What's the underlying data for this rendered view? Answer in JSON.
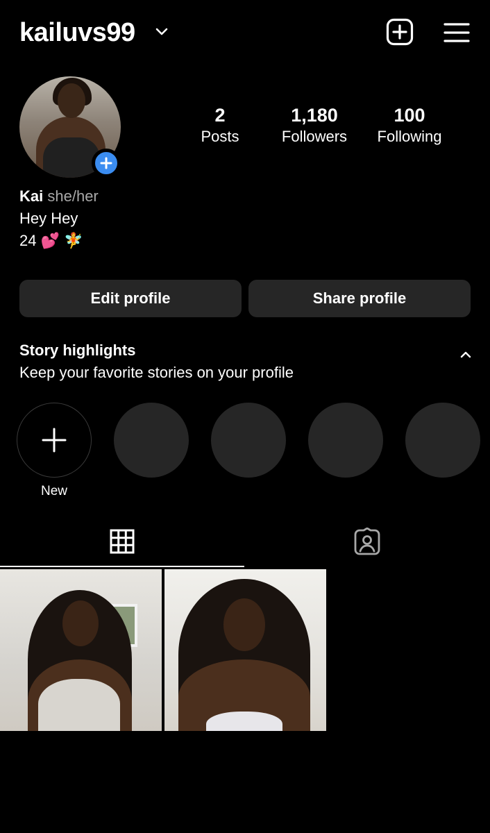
{
  "header": {
    "username": "kailuvs99",
    "icons": {
      "dropdown": "chevron-down-icon",
      "create": "plus-square-icon",
      "menu": "hamburger-menu-icon"
    }
  },
  "profile": {
    "avatar_badge_icon": "plus-icon",
    "stats": [
      {
        "value": "2",
        "label": "Posts"
      },
      {
        "value": "1,180",
        "label": "Followers"
      },
      {
        "value": "100",
        "label": "Following"
      }
    ],
    "name": "Kai",
    "pronouns": "she/her",
    "bio_line1": "Hey Hey",
    "bio_line2": "24 💕 🧚"
  },
  "actions": {
    "edit_label": "Edit profile",
    "share_label": "Share profile"
  },
  "highlights": {
    "title": "Story highlights",
    "subtitle": "Keep your favorite stories on your profile",
    "new_label": "New",
    "empty_slots": 4
  },
  "tabs": {
    "items": [
      "grid-icon",
      "tagged-person-icon"
    ],
    "active": "grid-icon"
  },
  "colors": {
    "background": "#000000",
    "button": "#262626",
    "badge": "#3b8df1",
    "secondary_text": "#a8a8a8"
  }
}
